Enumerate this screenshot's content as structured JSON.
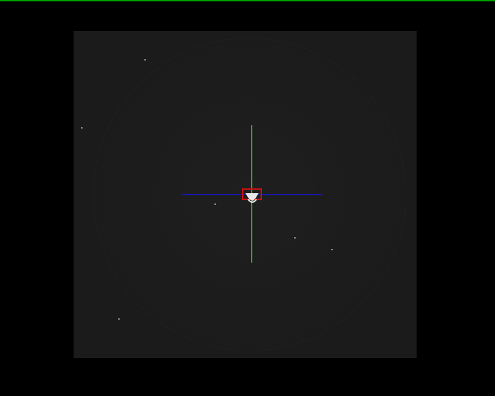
{
  "colors": {
    "top_bar": "#00a000",
    "background": "#000000",
    "sensor_frame": "#1b1b1b",
    "crosshair_vertical": "#22dd22",
    "crosshair_horizontal": "#1818a8",
    "target_box": "#cc1111",
    "target_fill": "#e8e8e8",
    "noise_specks": "#9a9a9a"
  },
  "icons": {
    "crosshair": "crosshair-icon",
    "target_marker": "target-box-icon"
  }
}
